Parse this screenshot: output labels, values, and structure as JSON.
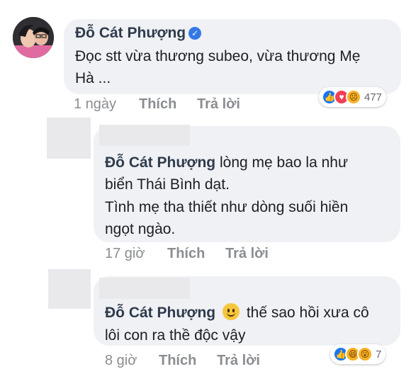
{
  "comments": [
    {
      "author": "Đỗ Cát Phượng",
      "verified": true,
      "line1": "Đọc stt vừa thương subeo, vừa thương Mẹ",
      "line2": "Hà ...",
      "time": "1 ngày",
      "like_label": "Thích",
      "reply_label": "Trả lời",
      "reactions": [
        "like-icon",
        "love-icon",
        "sad-icon"
      ],
      "reaction_count": "477"
    },
    {
      "mention": "Đỗ Cát Phượng",
      "line1": "lòng mẹ bao la như",
      "line2": "biển Thái Bình dạt.",
      "line3": "Tình mẹ tha thiết như dòng suối hiền",
      "line4": "ngọt ngào.",
      "time": "17 giờ",
      "like_label": "Thích",
      "reply_label": "Trả lời"
    },
    {
      "mention": "Đỗ Cát Phượng",
      "emoji": "smile-emoji",
      "line1": "thế sao hồi xưa cô",
      "line2": "lôi con ra thề độc vậy",
      "time": "8 giờ",
      "like_label": "Thích",
      "reply_label": "Trả lời",
      "reactions": [
        "like-icon",
        "haha-icon",
        "wow-icon"
      ],
      "reaction_count": "7"
    }
  ],
  "colors": {
    "bubble": "#eff1f4",
    "name": "#2f3b4c",
    "meta": "#8a8d91",
    "like_blue": "#1877f2",
    "love_red": "#f33e58",
    "emoji_yellow": "#f7b125"
  }
}
